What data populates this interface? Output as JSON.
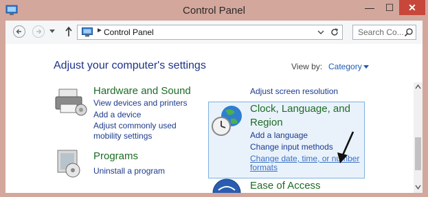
{
  "window": {
    "title": "Control Panel",
    "minimize": "—",
    "maximize": "☐",
    "close": "✕"
  },
  "navbar": {
    "address_sep": "►",
    "address_text": "Control Panel",
    "search_placeholder": "Search Co..."
  },
  "main": {
    "heading": "Adjust your computer's settings",
    "view_by_label": "View by:",
    "view_by_value": "Category"
  },
  "categories": {
    "hardware": {
      "title": "Hardware and Sound",
      "links": [
        "View devices and printers",
        "Add a device",
        "Adjust commonly used",
        "mobility settings"
      ]
    },
    "programs": {
      "title": "Programs",
      "links": [
        "Uninstall a program"
      ]
    },
    "appearance": {
      "links": [
        "Adjust screen resolution"
      ]
    },
    "clock": {
      "title": "Clock, Language, and Region",
      "links": [
        "Add a language",
        "Change input methods",
        "Change date, time, or number",
        "formats"
      ]
    },
    "ease": {
      "title": "Ease of Access"
    }
  },
  "colors": {
    "title_bar": "#d4a79c",
    "close_button": "#c7483b",
    "heading": "#1e3287",
    "category_title": "#1d6b24",
    "link": "#1c3a8c",
    "highlight_box": "#e9f2fb"
  }
}
